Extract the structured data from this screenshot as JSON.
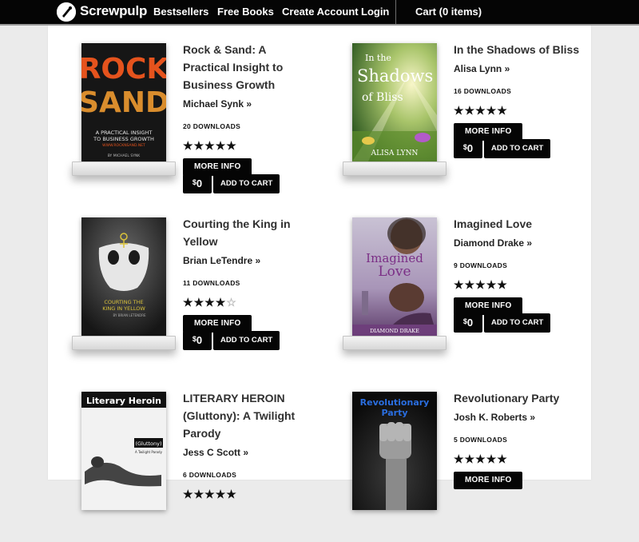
{
  "nav": {
    "brand": "Screwpulp",
    "links": [
      "Bestsellers",
      "Free Books",
      "Create Account",
      "Login"
    ],
    "cart": "Cart (0 items)"
  },
  "labels": {
    "more_info": "MORE INFO",
    "add_to_cart": "ADD TO CART",
    "currency": "$",
    "price": "0"
  },
  "books": [
    {
      "title": "Rock & Sand: A Practical Insight to Business Growth",
      "author": "Michael Synk »",
      "downloads": "20 DOWNLOADS",
      "rating": 5,
      "cover": {
        "line1": "ROCK",
        "line2": "SAND",
        "sub1": "A PRACTICAL INSIGHT",
        "sub2": "TO BUSINESS GROWTH",
        "url": "WWW.ROCKNSAND.NET",
        "by": "BY MICHAEL SYNK"
      }
    },
    {
      "title": "In the Shadows of Bliss",
      "author": "Alisa Lynn »",
      "downloads": "16 DOWNLOADS",
      "rating": 5,
      "cover": {
        "line1": "In the",
        "line2": "Shadows",
        "line3": "of Bliss",
        "by": "ALISA LYNN"
      }
    },
    {
      "title": "Courting the King in Yellow",
      "author": "Brian LeTendre »",
      "downloads": "11 DOWNLOADS",
      "rating": 4,
      "cover": {
        "line1": "COURTING THE",
        "line2": "KING IN YELLOW",
        "by": "BY BRIAN LETENDRE"
      }
    },
    {
      "title": "Imagined Love",
      "author": "Diamond Drake »",
      "downloads": "9 DOWNLOADS",
      "rating": 5,
      "cover": {
        "line1": "Imagined",
        "line2": "Love",
        "by": "DIAMOND DRAKE"
      }
    },
    {
      "title": "LITERARY HEROIN (Gluttony): A Twilight Parody",
      "author": "Jess C Scott »",
      "downloads": "6 DOWNLOADS",
      "rating": 5,
      "cover": {
        "line1": "Literary Heroin",
        "line2": "(Gluttony)",
        "line3": "A Twilight Parody"
      }
    },
    {
      "title": "Revolutionary Party",
      "author": "Josh K. Roberts »",
      "downloads": "5 DOWNLOADS",
      "rating": 5,
      "cover": {
        "line1": "Revolutionary",
        "line2": "Party"
      }
    }
  ]
}
